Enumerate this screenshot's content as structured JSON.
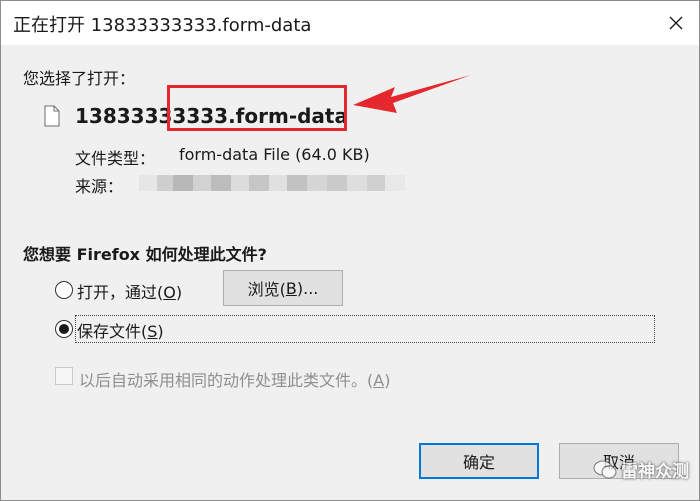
{
  "window": {
    "title": "正在打开 13833333333.form-data"
  },
  "selection": {
    "heading": "您选择了打开：",
    "filename": "13833333333.form-data",
    "type_label": "文件类型：",
    "type_value": "form-data File (64.0 KB)",
    "source_label": "来源："
  },
  "action": {
    "question": "您想要 Firefox 如何处理此文件?",
    "open_with": {
      "text": "打开，通过(",
      "key": "O",
      "suffix": ")"
    },
    "browse_button": {
      "text": "浏览(",
      "key": "B",
      "suffix": ")..."
    },
    "save_file": {
      "text": "保存文件(",
      "key": "S",
      "suffix": ")"
    },
    "remember": {
      "text": "以后自动采用相同的动作处理此类文件。(",
      "key": "A",
      "suffix": ")"
    }
  },
  "buttons": {
    "ok": "确定",
    "cancel": "取消"
  },
  "watermark": {
    "text": "雷神众测"
  },
  "colors": {
    "highlight": "#e5282d",
    "focus": "#0078d7"
  }
}
